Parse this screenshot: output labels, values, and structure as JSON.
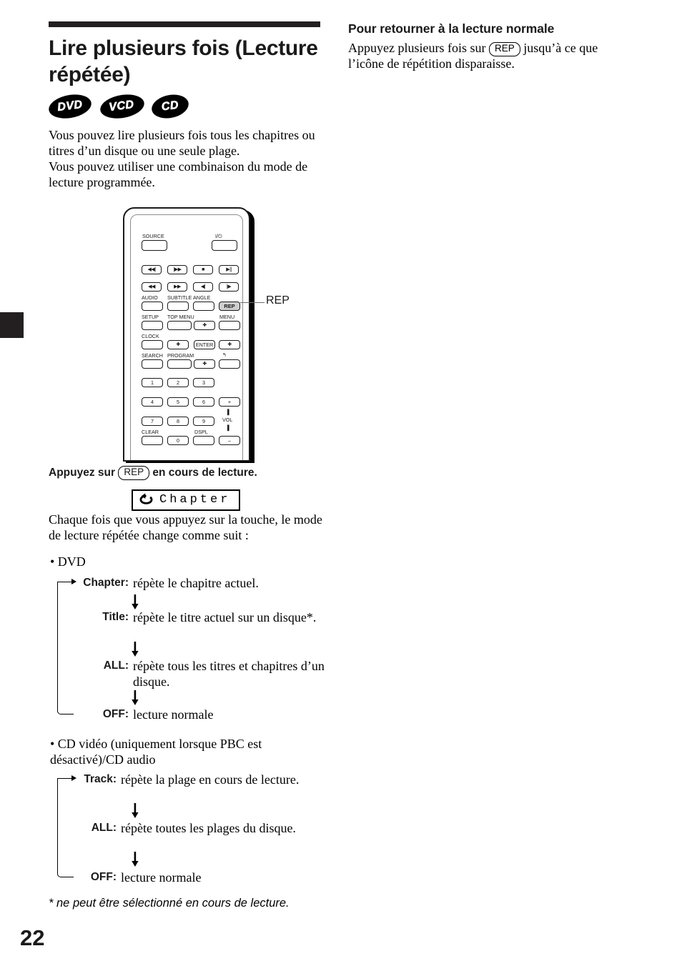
{
  "page": {
    "number": "22",
    "footnote": "* ne peut être sélectionné en cours de lecture."
  },
  "left_column": {
    "title": "Lire plusieurs fois (Lecture répétée)",
    "disc_badges": [
      {
        "label": "DVD",
        "name": "dvd-badge"
      },
      {
        "label": "VCD",
        "name": "vcd-badge"
      },
      {
        "label": "CD",
        "name": "cd-badge"
      }
    ],
    "intro_p1": "Vous pouvez lire plusieurs fois tous les chapitres ou titres d’un disque ou une seule plage.",
    "intro_p2": "Vous pouvez utiliser une combinaison du mode de lecture programmée.",
    "press_prefix": "Appuyez sur",
    "press_key": "REP",
    "press_suffix": "en cours de lecture.",
    "osd_label": "Chapter",
    "after_osd": "Chaque fois que vous appuyez sur la touche, le mode de lecture répétée change comme suit  :"
  },
  "right_column": {
    "heading": "Pour retourner à la lecture normale",
    "body_prefix": "Appuyez plusieurs fois sur",
    "body_key": "REP",
    "body_suffix": "jusqu’à ce que l’icône de répétition disparaisse."
  },
  "remote": {
    "callout_label": "REP",
    "buttons": [
      {
        "label": "SOURCE",
        "type": "label"
      },
      {
        "label": "I/⏻",
        "type": "label"
      },
      {
        "label": "◀◀|",
        "type": "glyph"
      },
      {
        "label": "|▶▶",
        "type": "glyph"
      },
      {
        "label": "■",
        "type": "glyph"
      },
      {
        "label": "▶||",
        "type": "glyph"
      },
      {
        "label": "◀◀",
        "type": "glyph"
      },
      {
        "label": "▶▶",
        "type": "glyph"
      },
      {
        "label": "◀|",
        "type": "glyph"
      },
      {
        "label": "|▶",
        "type": "glyph"
      },
      {
        "label": "AUDIO",
        "type": "label"
      },
      {
        "label": "SUBTITLE",
        "type": "label"
      },
      {
        "label": "ANGLE",
        "type": "label"
      },
      {
        "label": "REP",
        "type": "key-highlighted"
      },
      {
        "label": "SETUP",
        "type": "label"
      },
      {
        "label": "TOP MENU",
        "type": "label"
      },
      {
        "label": "MENU",
        "type": "label"
      },
      {
        "label": "CLOCK",
        "type": "label"
      },
      {
        "label": "ENTER",
        "type": "key"
      },
      {
        "label": "SEARCH",
        "type": "label"
      },
      {
        "label": "PROGRAM",
        "type": "label"
      },
      {
        "label": "1",
        "type": "num"
      },
      {
        "label": "2",
        "type": "num"
      },
      {
        "label": "3",
        "type": "num"
      },
      {
        "label": "4",
        "type": "num"
      },
      {
        "label": "5",
        "type": "num"
      },
      {
        "label": "6",
        "type": "num"
      },
      {
        "label": "7",
        "type": "num"
      },
      {
        "label": "8",
        "type": "num"
      },
      {
        "label": "9",
        "type": "num"
      },
      {
        "label": "0",
        "type": "num"
      },
      {
        "label": "CLEAR",
        "type": "label"
      },
      {
        "label": "DSPL",
        "type": "label"
      },
      {
        "label": "VOL",
        "type": "label"
      },
      {
        "label": "+",
        "type": "key"
      },
      {
        "label": "–",
        "type": "key"
      }
    ],
    "row_labels": {
      "source": "SOURCE",
      "power": "I/⏻",
      "audio": "AUDIO",
      "subtitle": "SUBTITLE",
      "angle": "ANGLE",
      "rep": "REP",
      "setup": "SETUP",
      "topmenu": "TOP MENU",
      "menu": "MENU",
      "clock": "CLOCK",
      "enter": "ENTER",
      "search": "SEARCH",
      "program": "PROGRAM",
      "clear": "CLEAR",
      "dspl": "DSPL",
      "vol": "VOL",
      "plus": "+",
      "minus": "–",
      "n1": "1",
      "n2": "2",
      "n3": "3",
      "n4": "4",
      "n5": "5",
      "n6": "6",
      "n7": "7",
      "n8": "8",
      "n9": "9",
      "n0": "0"
    }
  },
  "flows": [
    {
      "id": "dvd",
      "bullet": "• DVD",
      "items": [
        {
          "label": "Chapter:",
          "desc": "répète le chapitre actuel."
        },
        {
          "label": "Title:",
          "desc": "répète le titre actuel sur un disque*."
        },
        {
          "label": "ALL:",
          "desc": "répète tous les titres et chapitres d’un disque."
        },
        {
          "label": "OFF:",
          "desc": "lecture normale"
        }
      ]
    },
    {
      "id": "cd",
      "bullet": "• CD vidéo (uniquement lorsque PBC est désactivé)/CD audio",
      "items": [
        {
          "label": "Track:",
          "desc": "répète la plage en cours de lecture."
        },
        {
          "label": "ALL:",
          "desc": "répète toutes les plages du disque."
        },
        {
          "label": "OFF:",
          "desc": "lecture normale"
        }
      ]
    }
  ]
}
